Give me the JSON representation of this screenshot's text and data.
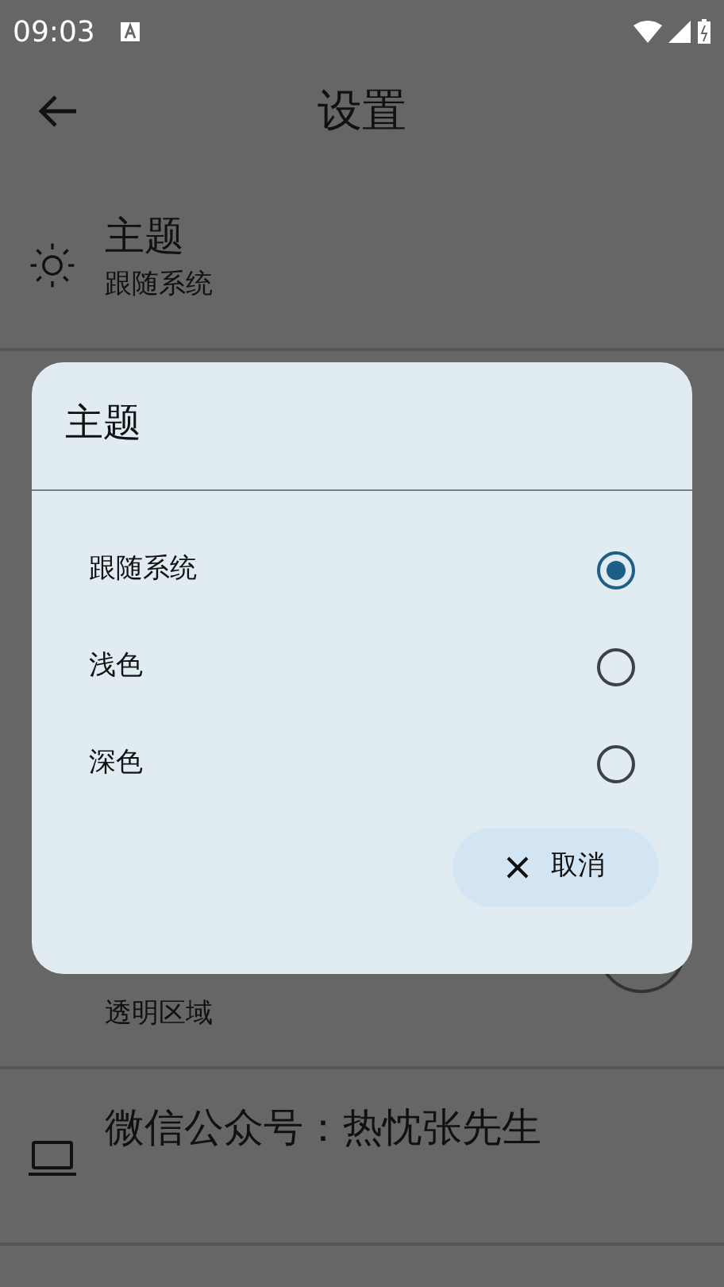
{
  "status_bar": {
    "time": "09:03"
  },
  "header": {
    "title": "设置"
  },
  "settings": [
    {
      "kind": "theme",
      "title": "主题",
      "subtitle": "跟随系统"
    },
    {
      "kind": "partial",
      "subtitle": "透明区域"
    },
    {
      "kind": "laptop",
      "title": "微信公众号：热忱张先生"
    }
  ],
  "dialog": {
    "title": "主题",
    "options": [
      {
        "label": "跟随系统",
        "selected": true
      },
      {
        "label": "浅色",
        "selected": false
      },
      {
        "label": "深色",
        "selected": false
      }
    ],
    "cancel": "取消"
  }
}
